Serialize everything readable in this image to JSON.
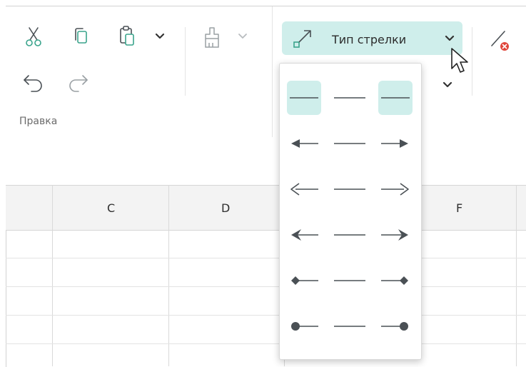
{
  "ribbon": {
    "group_label": "Правка",
    "arrow_type_button": {
      "label": "Тип стрелки"
    }
  },
  "columns": [
    "C",
    "D",
    "F"
  ],
  "arrow_menu": {
    "rows": [
      {
        "name": "none",
        "start": "none",
        "end": "none",
        "start_selected": true,
        "end_selected": true
      },
      {
        "name": "arrow",
        "start": "arrow",
        "end": "arrow",
        "start_selected": false,
        "end_selected": false
      },
      {
        "name": "open",
        "start": "open",
        "end": "open",
        "start_selected": false,
        "end_selected": false
      },
      {
        "name": "stealth",
        "start": "stealth",
        "end": "stealth",
        "start_selected": false,
        "end_selected": false
      },
      {
        "name": "diamond",
        "start": "diamond",
        "end": "diamond",
        "start_selected": false,
        "end_selected": false
      },
      {
        "name": "oval",
        "start": "oval",
        "end": "oval",
        "start_selected": false,
        "end_selected": false
      }
    ]
  },
  "colors": {
    "accent": "#cfeeeb",
    "icon": "#4a5055",
    "green": "#3aa48c"
  }
}
